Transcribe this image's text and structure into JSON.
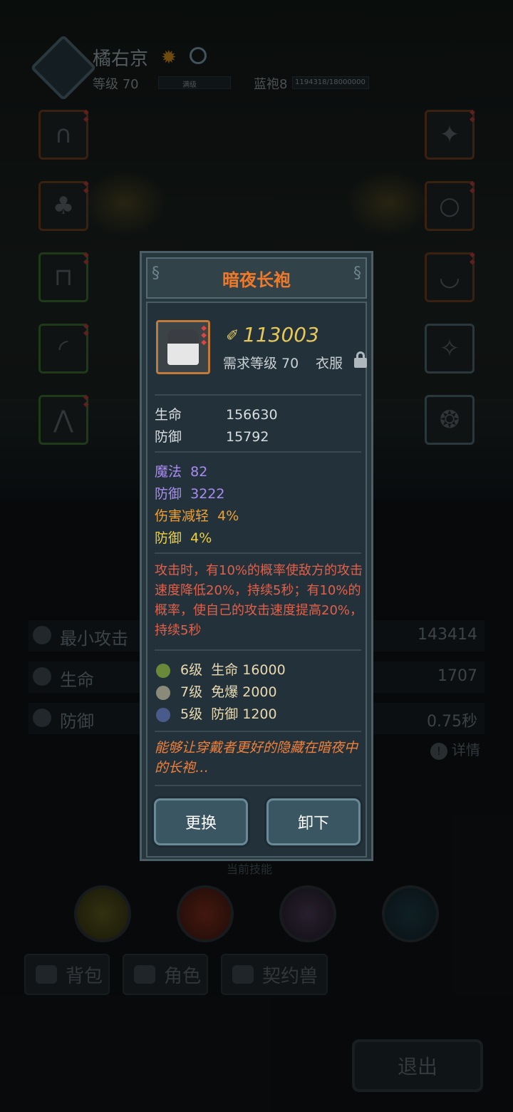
{
  "header": {
    "name": "橘右京",
    "level_label": "等级 70",
    "level_bar_text": "满级",
    "rank_label": "蓝袍8",
    "exp_text": "1194318/18000000"
  },
  "stats": [
    {
      "label": "最小攻击",
      "value": "143414"
    },
    {
      "label": "生命",
      "value": "1707"
    },
    {
      "label": "防御",
      "value": "0.75秒"
    }
  ],
  "details_label": "详情",
  "skills_label": "当前技能",
  "tabs": [
    "背包",
    "角色",
    "契约兽"
  ],
  "exit_label": "退出",
  "item": {
    "title": "暗夜长袍",
    "score": "113003",
    "requirement": "需求等级 70",
    "slot_type": "衣服",
    "base_stats": [
      {
        "name": "生命",
        "value": "156630"
      },
      {
        "name": "防御",
        "value": "15792"
      }
    ],
    "extra_stats": [
      {
        "name": "魔法",
        "value": "82",
        "color": "#a98cf2"
      },
      {
        "name": "防御",
        "value": "3222",
        "color": "#a98cf2"
      },
      {
        "name": "伤害减轻",
        "value": "4%",
        "color": "#f0a030"
      },
      {
        "name": "防御",
        "value": "4%",
        "color": "#f0cf3c"
      }
    ],
    "description": "攻击时，有10%的概率使敌方的攻击速度降低20%，持续5秒；有10%的概率，使自己的攻击速度提高20%，持续5秒",
    "set_bonuses": [
      {
        "level": "6级",
        "bonus": "生命 16000"
      },
      {
        "level": "7级",
        "bonus": "免爆 2000"
      },
      {
        "level": "5级",
        "bonus": "防御 1200"
      }
    ],
    "lore": "能够让穿戴者更好的隐藏在暗夜中的长袍…",
    "buttons": {
      "replace": "更换",
      "unequip": "卸下"
    }
  },
  "colors": {
    "title": "#f07a2a",
    "score": "#e6c85a",
    "description": "#e2604a",
    "lore": "#f0803a"
  }
}
